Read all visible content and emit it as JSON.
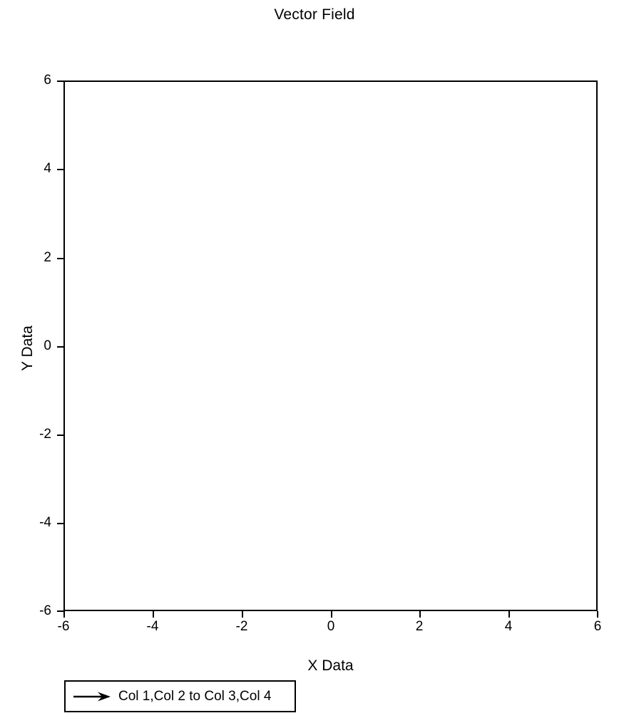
{
  "chart_data": {
    "type": "scatter",
    "title": "Vector Field",
    "xlabel": "X Data",
    "ylabel": "Y Data",
    "xlim": [
      -6,
      6
    ],
    "ylim": [
      -6,
      6
    ],
    "xticks": [
      -6,
      -4,
      -2,
      0,
      2,
      4,
      6
    ],
    "yticks": [
      -6,
      -4,
      -2,
      0,
      2,
      4,
      6
    ],
    "xticklabels": [
      "-6",
      "-4",
      "-2",
      "0",
      "2",
      "4",
      "6"
    ],
    "yticklabels": [
      "-6",
      "-4",
      "-2",
      "0",
      "2",
      "4",
      "6"
    ],
    "grid": false,
    "legend_position": "below-left",
    "series": [
      {
        "name": "Col 1,Col 2 to Col 3,Col 4",
        "marker": "arrow",
        "color": "#000000",
        "x": [],
        "y": [],
        "u": [],
        "v": []
      }
    ],
    "annotations": []
  },
  "figure": {
    "background_color": "#ffffff",
    "foreground_color": "#000000"
  },
  "title": {
    "text": "Vector Field"
  },
  "axes": {
    "x": {
      "label": "X Data",
      "ticks": [
        {
          "value": "-6",
          "px": 89
        },
        {
          "value": "-4",
          "px": 214
        },
        {
          "value": "-2",
          "px": 339
        },
        {
          "value": "0",
          "px": 464
        },
        {
          "value": "2",
          "px": 588
        },
        {
          "value": "4",
          "px": 713
        },
        {
          "value": "6",
          "px": 838
        }
      ]
    },
    "y": {
      "label": "Y Data",
      "ticks": [
        {
          "value": "6",
          "px": 113
        },
        {
          "value": "4",
          "px": 237
        },
        {
          "value": "2",
          "px": 362
        },
        {
          "value": "0",
          "px": 486
        },
        {
          "value": "-2",
          "px": 610
        },
        {
          "value": "-4",
          "px": 734
        },
        {
          "value": "-6",
          "px": 858
        }
      ]
    }
  },
  "legend": {
    "entries": [
      {
        "icon": "right-arrow-icon",
        "label": "Col 1,Col 2 to Col 3,Col 4",
        "color": "#000000"
      }
    ]
  }
}
